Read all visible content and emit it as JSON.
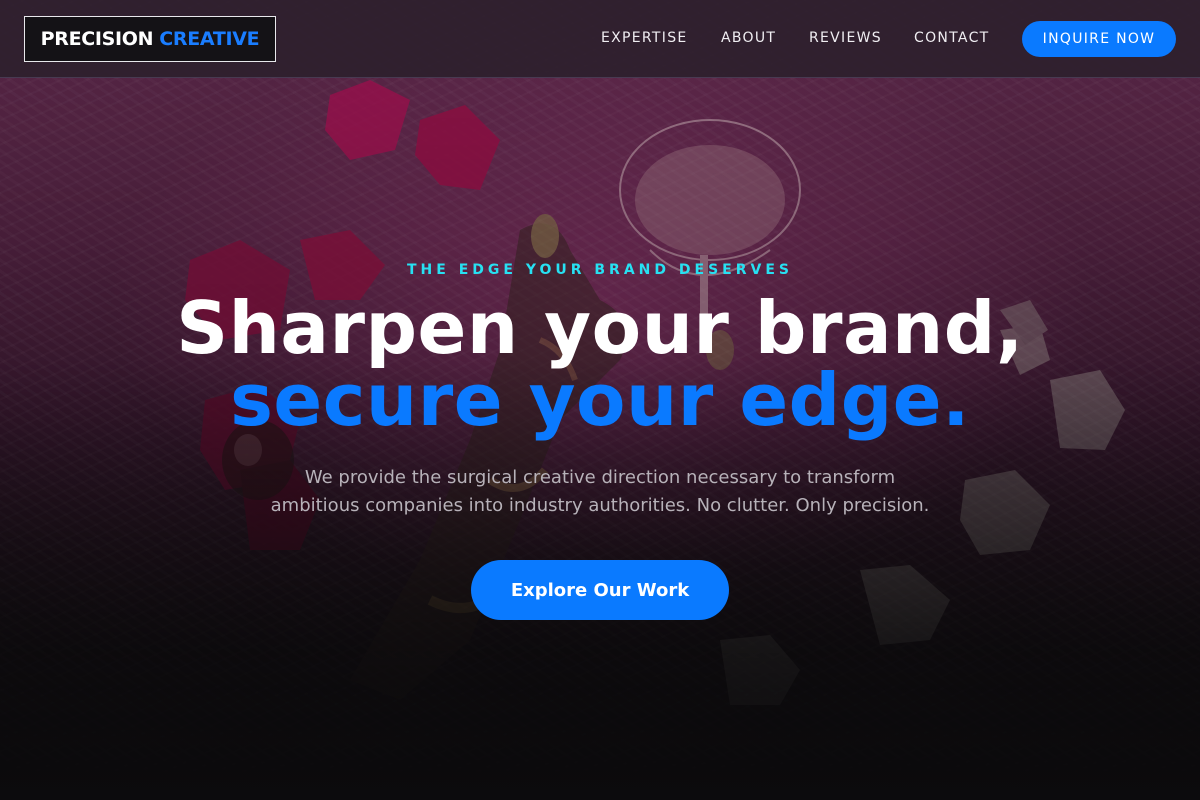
{
  "header": {
    "logo": {
      "part1": "PRECISION",
      "part2": "CREATIVE"
    },
    "nav": [
      {
        "label": "EXPERTISE"
      },
      {
        "label": "ABOUT"
      },
      {
        "label": "REVIEWS"
      },
      {
        "label": "CONTACT"
      }
    ],
    "cta_label": "INQUIRE NOW"
  },
  "hero": {
    "eyebrow": "THE EDGE YOUR BRAND DESERVES",
    "headline_line1": "Sharpen your brand,",
    "headline_line2": "secure your edge.",
    "lede_line1": "We provide the surgical creative direction necessary to transform",
    "lede_line2": "ambitious companies into industry authorities. No clutter. Only precision.",
    "cta_label": "Explore Our Work"
  },
  "colors": {
    "accent_blue": "#0a7aff",
    "eyebrow_cyan": "#27e1f2",
    "background_dark": "#0c0b0d"
  }
}
